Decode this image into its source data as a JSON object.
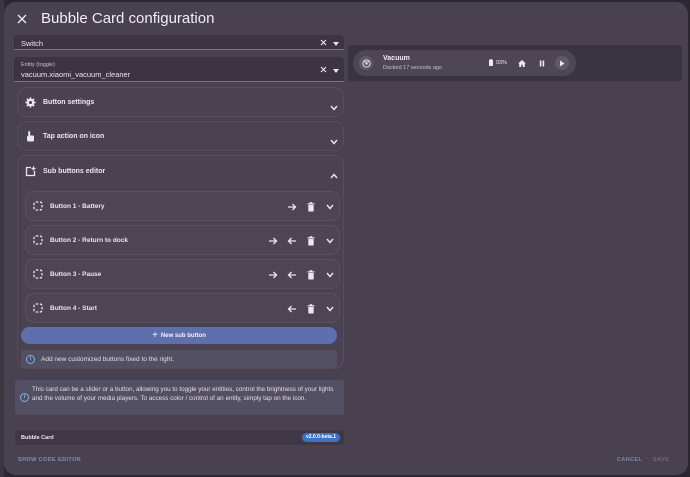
{
  "dialog": {
    "title": "Bubble Card configuration"
  },
  "editor": {
    "card_type_field": {
      "value": "Switch"
    },
    "entity_field": {
      "label": "Entity (toggle)",
      "value": "vacuum.xiaomi_vacuum_cleaner"
    },
    "panels": {
      "button_settings": "Button settings",
      "tap_action": "Tap action on icon",
      "sub_buttons_editor": "Sub buttons editor"
    },
    "sub_buttons": [
      {
        "label": "Button 1 - Battery"
      },
      {
        "label": "Button 2 - Return to dock"
      },
      {
        "label": "Button 3 - Pause"
      },
      {
        "label": "Button 4 - Start"
      }
    ],
    "new_sub_button": "New sub button",
    "sub_info": "Add new customized buttons fixed to the right.",
    "card_info": "This card can be a slider or a button, allowing you to toggle your entities, control the brightness of your lights and the volume of your media players. To access color / control of an entity, simply tap on the icon.",
    "footer_card": {
      "title": "Bubble Card",
      "version": "v2.0.0-beta.1"
    }
  },
  "actions": {
    "show_code_editor": "SHOW CODE EDITOR",
    "cancel": "CANCEL",
    "save": "SAVE"
  },
  "preview": {
    "name": "Vacuum",
    "state": "Docked 17 seconds ago",
    "battery": "93%"
  },
  "colors": {
    "accent": "#5f6fae",
    "info": "#7ab0e8",
    "badge": "#3c73c6",
    "dialog_bg": "#4a4150"
  }
}
